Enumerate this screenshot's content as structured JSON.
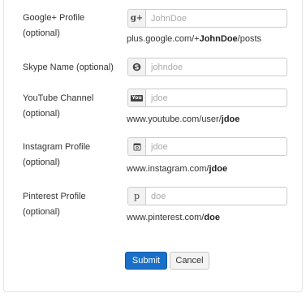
{
  "fields": [
    {
      "label": "Google+ Profile (optional)",
      "icon": "google-plus-icon",
      "icon_glyph": "g+",
      "placeholder": "JohnDoe",
      "hint_prefix": "plus.google.com/+",
      "hint_bold": "JohnDoe",
      "hint_suffix": "/posts"
    },
    {
      "label": "Skype Name (optional)",
      "icon": "skype-icon",
      "icon_glyph": "S",
      "placeholder": "johndoe"
    },
    {
      "label_line1": "YouTube Channel",
      "label_line2": "(optional)",
      "icon": "youtube-icon",
      "icon_glyph": "You",
      "placeholder": "jdoe",
      "hint_prefix": "www.youtube.com/user/",
      "hint_bold": "jdoe"
    },
    {
      "label_line1": "Instagram Profile",
      "label_line2": "(optional)",
      "icon": "instagram-icon",
      "icon_glyph": "◙",
      "placeholder": "jdoe",
      "hint_prefix": "www.instagram.com/",
      "hint_bold": "jdoe"
    },
    {
      "label_line1": "Pinterest Profile",
      "label_line2": "(optional)",
      "icon": "pinterest-icon",
      "icon_glyph": "𝓅",
      "placeholder": "doe",
      "hint_prefix": "www.pinterest.com/",
      "hint_bold": "doe"
    }
  ],
  "buttons": {
    "submit": "Submit",
    "cancel": "Cancel"
  },
  "colors": {
    "primary": "#1a6fc9",
    "border": "#cccccc",
    "addon_bg": "#f2f2f2"
  }
}
